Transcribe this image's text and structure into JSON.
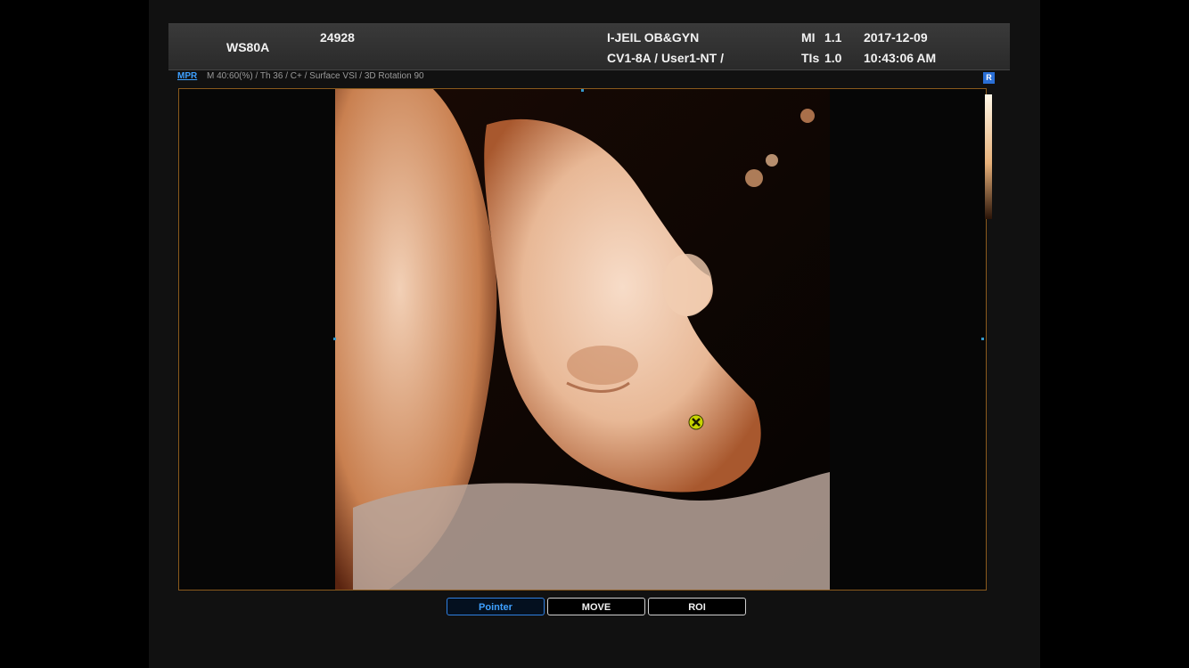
{
  "header": {
    "model": "WS80A",
    "patient_id": "24928",
    "institution": "I-JEIL OB&GYN",
    "probe_preset": "CV1-8A / User1-NT /",
    "mi_label": "MI",
    "mi_value": "1.1",
    "tis_label": "TIs",
    "tis_value": "1.0",
    "date": "2017-12-09",
    "time": "10:43:06 AM"
  },
  "subbar": {
    "mode": "MPR",
    "params": "M 40:60(%) / Th 36 / C+ / Surface VSI / 3D Rotation 90"
  },
  "corner_icon": {
    "glyph": "R",
    "icon": "render-mode-icon"
  },
  "buttons": [
    {
      "label": "Pointer",
      "active": true
    },
    {
      "label": "MOVE",
      "active": false
    },
    {
      "label": "ROI",
      "active": false
    }
  ],
  "colors": {
    "accent": "#3ea0ff",
    "viewport_border": "#8a5a1c",
    "tissue_light": "#f3d3bc",
    "tissue_dark": "#b86a3e"
  }
}
